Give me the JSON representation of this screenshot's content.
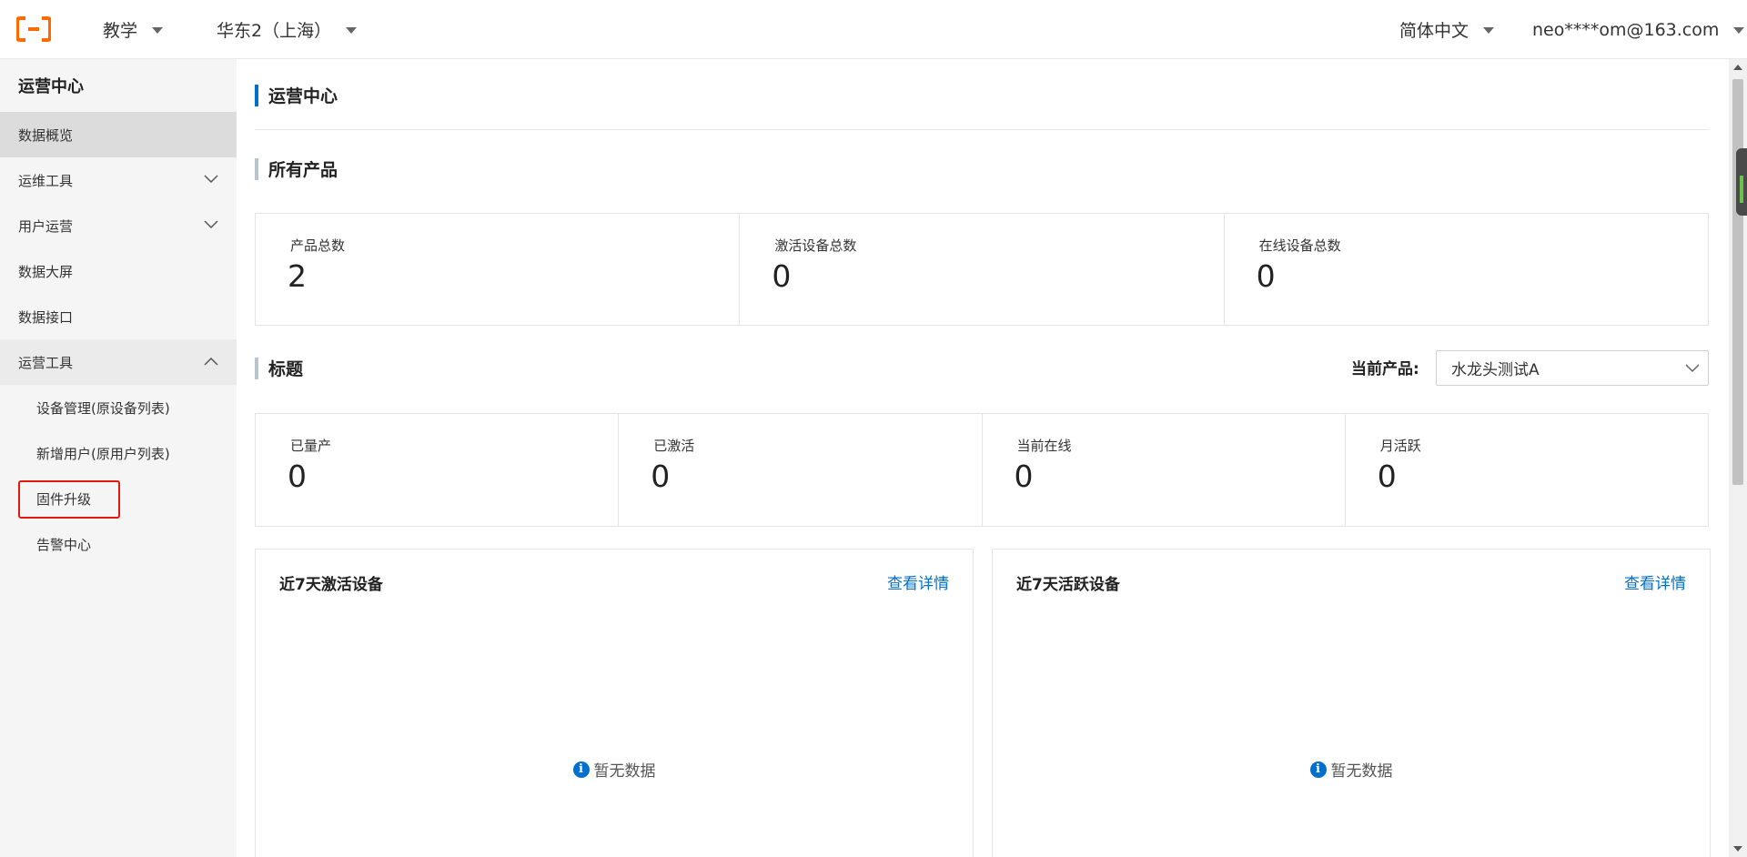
{
  "topbar": {
    "logo_icon": "aliyun-logo-icon",
    "brand_color": "#ff6a00",
    "workspace": "教学",
    "region": "华东2（上海）",
    "language": "简体中文",
    "account": "neo****om@163.com"
  },
  "sidebar": {
    "title": "运营中心",
    "items": [
      {
        "label": "数据概览",
        "state": "active"
      },
      {
        "label": "运维工具",
        "expandable": true,
        "expanded": false
      },
      {
        "label": "用户运营",
        "expandable": true,
        "expanded": false
      },
      {
        "label": "数据大屏"
      },
      {
        "label": "数据接口"
      },
      {
        "label": "运营工具",
        "expandable": true,
        "expanded": true
      }
    ],
    "sub_items": [
      {
        "label": "设备管理(原设备列表)"
      },
      {
        "label": "新增用户(原用户列表)"
      },
      {
        "label": "固件升级",
        "highlighted": true
      },
      {
        "label": "告警中心"
      }
    ]
  },
  "main": {
    "page_title": "运营中心",
    "all_products": {
      "title": "所有产品",
      "stats": [
        {
          "label": "产品总数",
          "value": "2"
        },
        {
          "label": "激活设备总数",
          "value": "0"
        },
        {
          "label": "在线设备总数",
          "value": "0"
        }
      ]
    },
    "product_section": {
      "title": "标题",
      "select_label": "当前产品:",
      "selected_product": "水龙头测试A",
      "stats": [
        {
          "label": "已量产",
          "value": "0"
        },
        {
          "label": "已激活",
          "value": "0"
        },
        {
          "label": "当前在线",
          "value": "0"
        },
        {
          "label": "月活跃",
          "value": "0"
        }
      ]
    },
    "cards": [
      {
        "title": "近7天激活设备",
        "link": "查看详情",
        "empty_text": "暂无数据"
      },
      {
        "title": "近7天活跃设备",
        "link": "查看详情",
        "empty_text": "暂无数据"
      }
    ]
  },
  "colors": {
    "accent": "#0070cc",
    "highlight_border": "#e6190e",
    "sidebar_bg": "#f5f5f5"
  }
}
